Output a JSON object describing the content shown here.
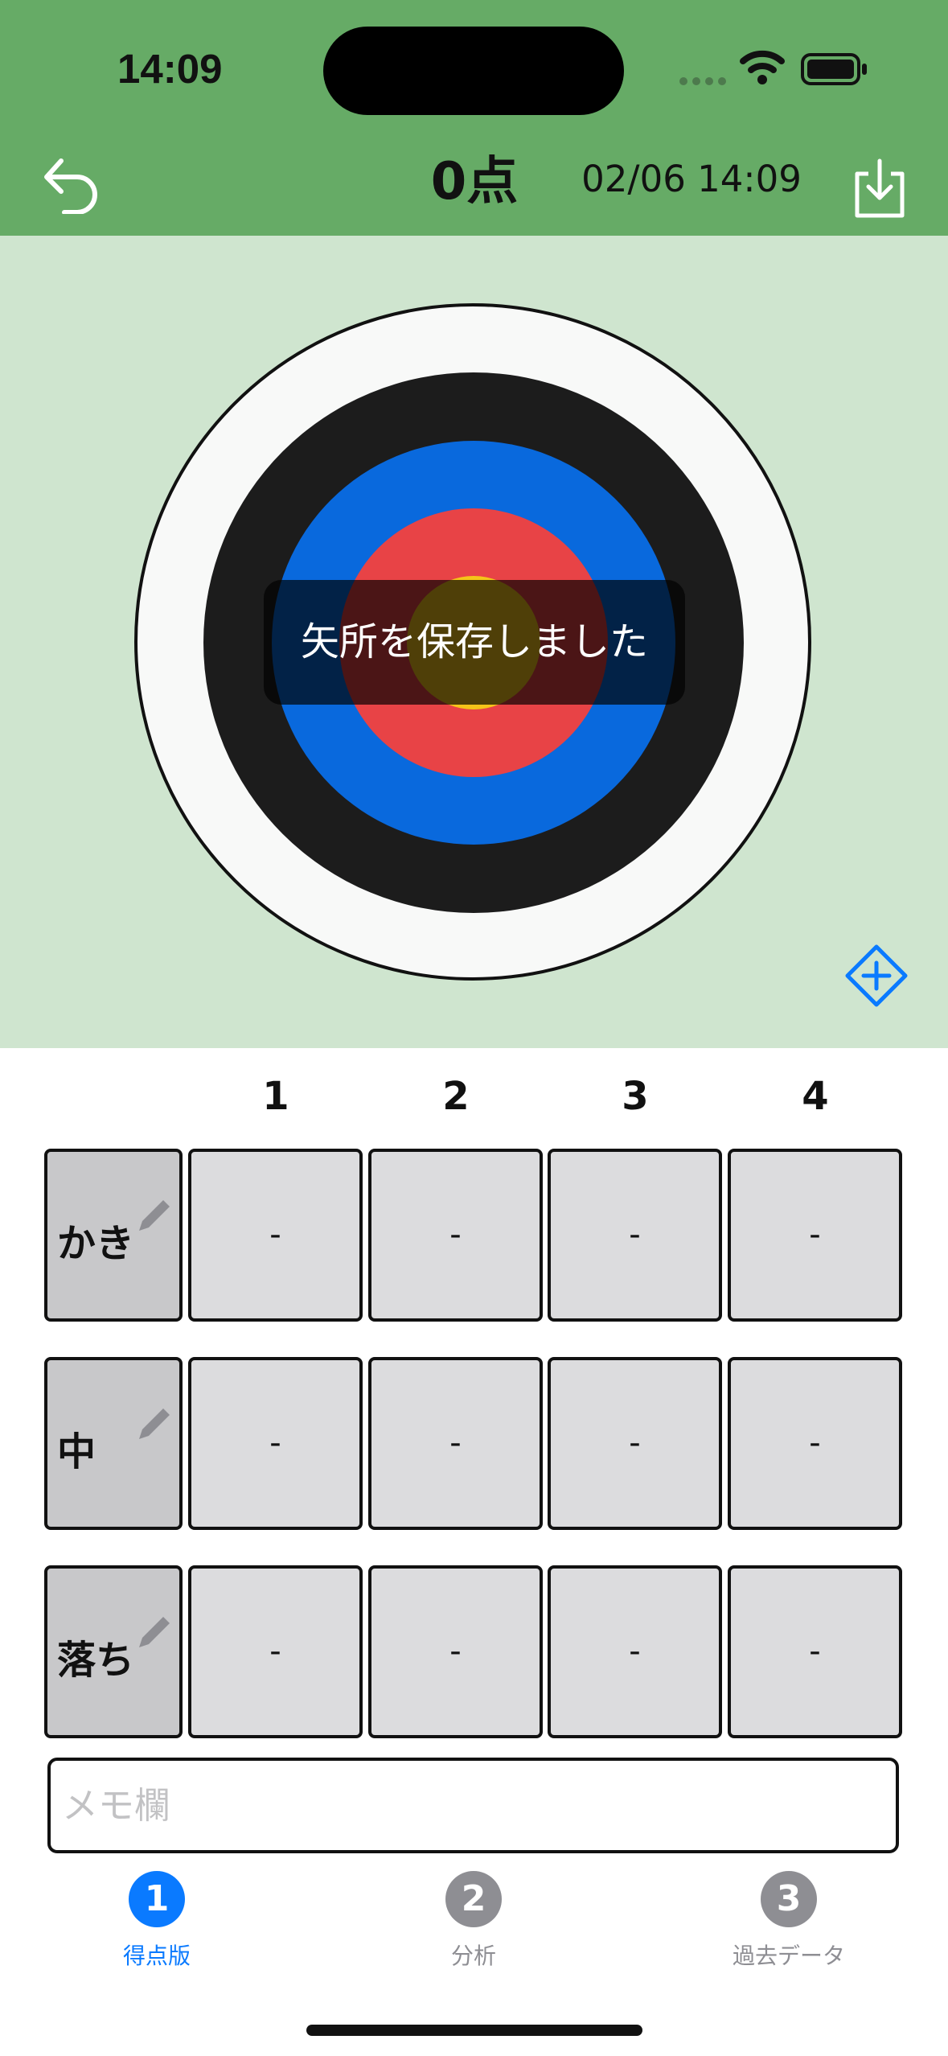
{
  "status_bar": {
    "time": "14:09"
  },
  "header": {
    "score_label": "0点",
    "date_time": "02/06 14:09"
  },
  "toast": {
    "message": "矢所を保存しました"
  },
  "score_table": {
    "columns": [
      "1",
      "2",
      "3",
      "4"
    ],
    "rows": [
      {
        "label": "かき",
        "cells": [
          "-",
          "-",
          "-",
          "-"
        ]
      },
      {
        "label": "中",
        "cells": [
          "-",
          "-",
          "-",
          "-"
        ]
      },
      {
        "label": "落ち",
        "cells": [
          "-",
          "-",
          "-",
          "-"
        ]
      }
    ]
  },
  "memo": {
    "placeholder": "メモ欄"
  },
  "tabs": [
    {
      "number": "1",
      "label": "得点版",
      "active": true
    },
    {
      "number": "2",
      "label": "分析",
      "active": false
    },
    {
      "number": "3",
      "label": "過去データ",
      "active": false
    }
  ],
  "colors": {
    "header_green": "#66ab66",
    "target_bg": "#cfe5cf",
    "active_tab": "#0a7aff",
    "inactive_tab": "#8e8e93"
  }
}
